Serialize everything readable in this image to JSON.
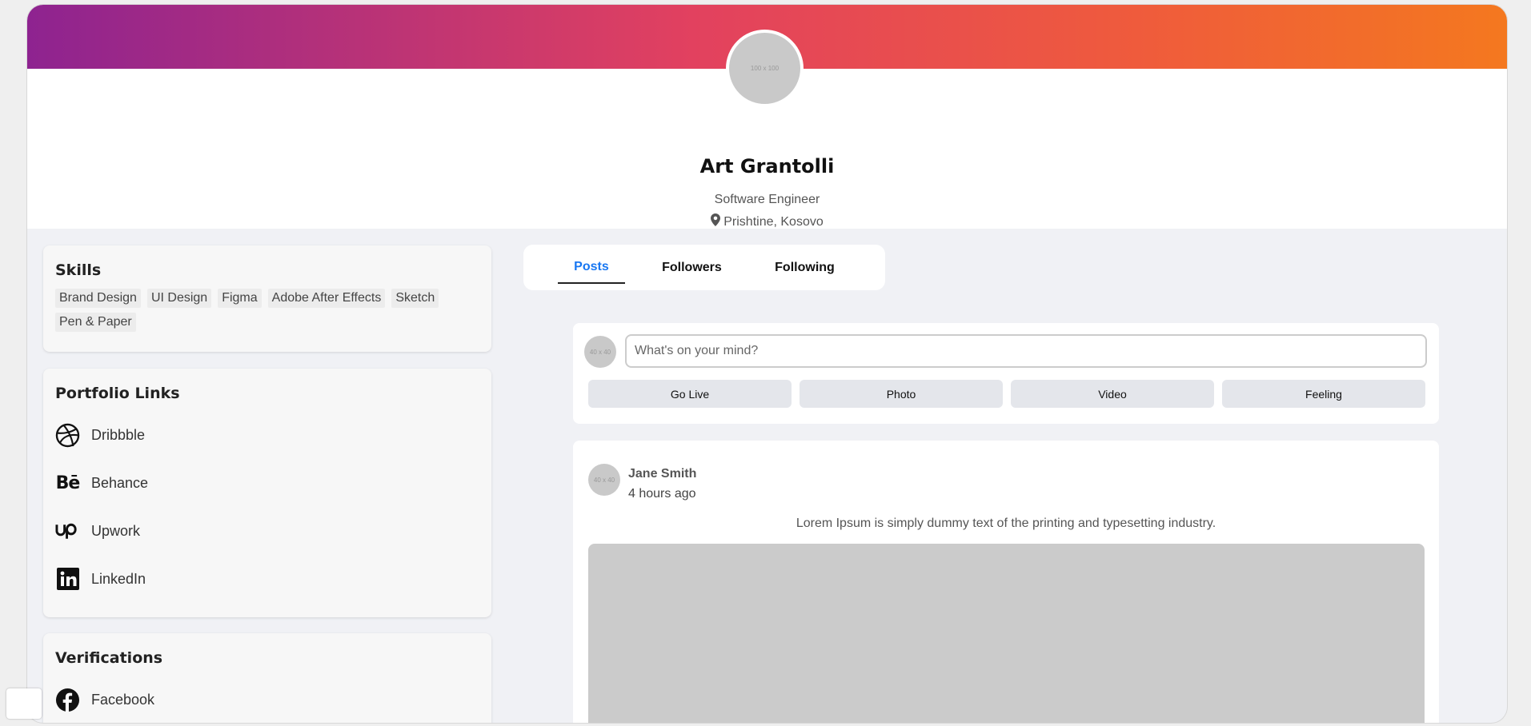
{
  "profile": {
    "avatar_label": "100 x 100",
    "name": "Art Grantolli",
    "role": "Software Engineer",
    "location": "Prishtine, Kosovo"
  },
  "skills": {
    "title": "Skills",
    "items": [
      "Brand Design",
      "UI Design",
      "Figma",
      "Adobe After Effects",
      "Sketch",
      "Pen & Paper"
    ]
  },
  "portfolio": {
    "title": "Portfolio Links",
    "links": [
      {
        "label": "Dribbble",
        "icon": "dribbble-icon"
      },
      {
        "label": "Behance",
        "icon": "behance-icon"
      },
      {
        "label": "Upwork",
        "icon": "upwork-icon"
      },
      {
        "label": "LinkedIn",
        "icon": "linkedin-icon"
      }
    ]
  },
  "verifications": {
    "title": "Verifications",
    "items": [
      {
        "label": "Facebook",
        "icon": "facebook-icon"
      }
    ]
  },
  "tabs": [
    {
      "label": "Posts",
      "active": true
    },
    {
      "label": "Followers",
      "active": false
    },
    {
      "label": "Following",
      "active": false
    }
  ],
  "composer": {
    "avatar_label": "40 x 40",
    "placeholder": "What's on your mind?",
    "actions": [
      "Go Live",
      "Photo",
      "Video",
      "Feeling"
    ]
  },
  "post": {
    "avatar_label": "40 x 40",
    "author": "Jane Smith",
    "time": "4 hours ago",
    "text": "Lorem Ipsum is simply dummy text of the printing and typesetting industry."
  },
  "colors": {
    "accent": "#1877f2",
    "banner_start": "#8e2390",
    "banner_end": "#f4781f"
  }
}
